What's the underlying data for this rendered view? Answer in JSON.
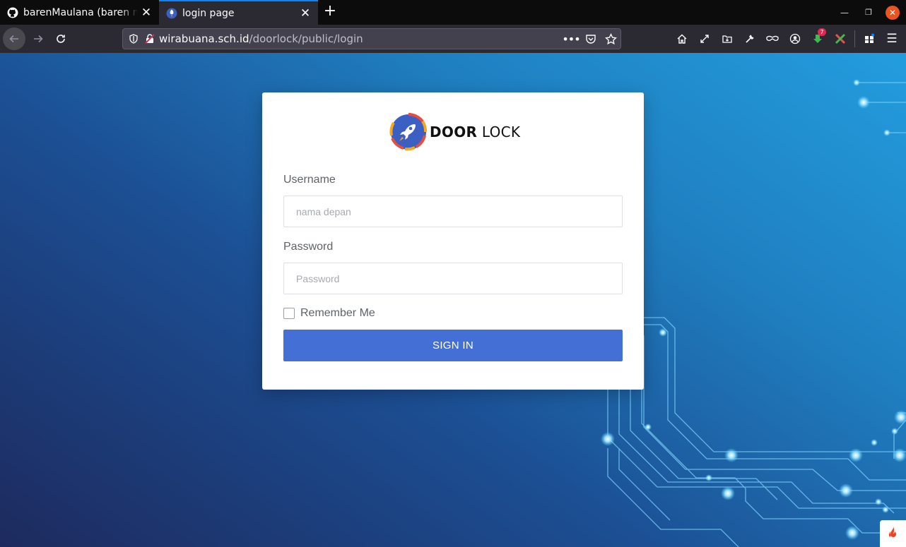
{
  "browser": {
    "tabs": [
      {
        "title": "barenMaulana (baren maulana)",
        "favicon": "github-icon",
        "active": false
      },
      {
        "title": "login page",
        "favicon": "rocket-icon",
        "active": true
      }
    ],
    "url": {
      "host": "wirabuana.sch.id",
      "path": "/doorlock/public/login"
    },
    "notification_badge": "7"
  },
  "login": {
    "brand": {
      "bold": "DOOR",
      "normal": " LOCK"
    },
    "username_label": "Username",
    "username_placeholder": "nama depan",
    "password_label": "Password",
    "password_placeholder": "Password",
    "remember_label": "Remember Me",
    "remember_checked": false,
    "submit_label": "SIGN IN"
  },
  "colors": {
    "primary_button": "#4470d6",
    "background_start": "#1d2a5e",
    "background_end": "#239dde",
    "tab_accent": "#0a84ff"
  }
}
